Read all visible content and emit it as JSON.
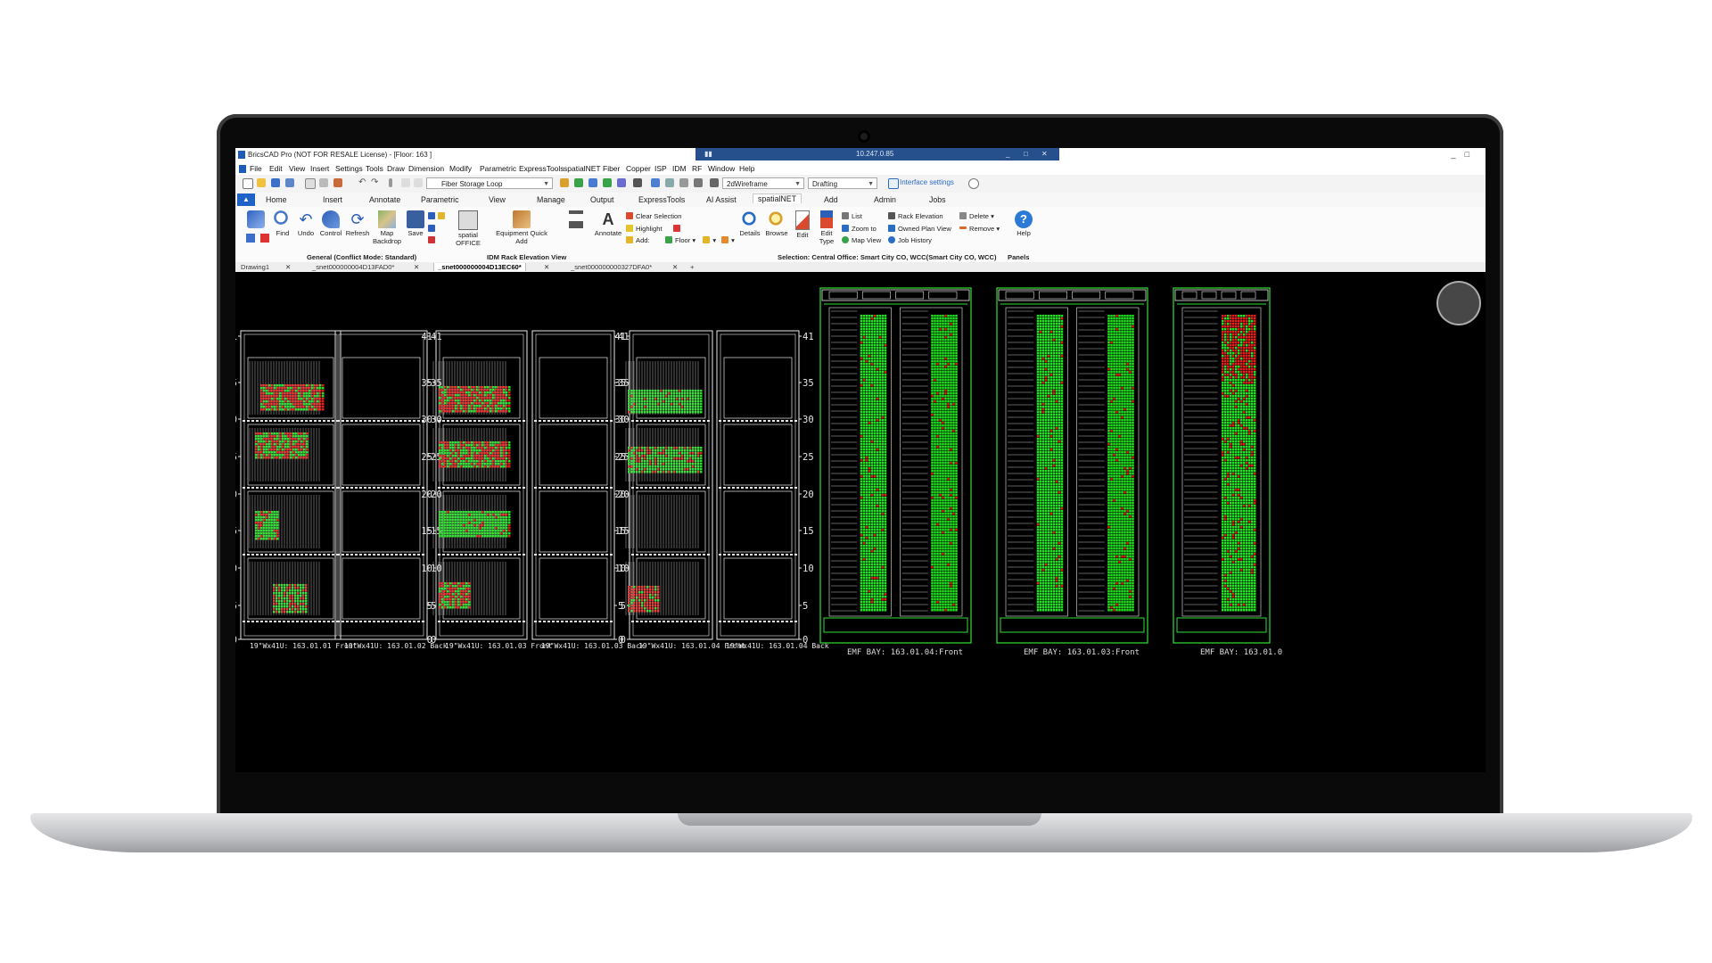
{
  "window": {
    "title": "BricsCAD Pro (NOT FOR RESALE License) - [Floor: 163 ]",
    "remote_host": "10.247.0.85",
    "controls": [
      "_",
      "□",
      "✕"
    ]
  },
  "menu": [
    "File",
    "Edit",
    "View",
    "Insert",
    "Settings",
    "Tools",
    "Draw",
    "Dimension",
    "Modify",
    "Parametric",
    "ExpressTools",
    "spatialNET",
    "Fiber",
    "Copper",
    "ISP",
    "IDM",
    "RF",
    "Window",
    "Help"
  ],
  "toolbar": {
    "layer_combo": "Fiber Storage Loop",
    "visual_style": "2dWireframe",
    "workspace": "Drafting",
    "interface_settings": "Interface settings"
  },
  "tabs": [
    "Home",
    "Insert",
    "Annotate",
    "Parametric",
    "View",
    "Manage",
    "Output",
    "ExpressTools",
    "AI Assist",
    "spatialNET",
    "Add",
    "Admin",
    "Jobs"
  ],
  "active_tab": "spatialNET",
  "ribbon": {
    "buttons": [
      "Find",
      "Undo",
      "Control",
      "Refresh",
      "Map Backdrop",
      "Save",
      "spatial OFFICE",
      "Equipment Quick Add",
      "Annotate",
      "Details",
      "Browse",
      "Edit",
      "Edit Type",
      "Help"
    ],
    "small_buttons": [
      "Clear Selection",
      "Highlight",
      "Add:",
      "Floor",
      "List",
      "Zoom to",
      "Map View",
      "Rack Elevation",
      "Owned Plan View",
      "Job History",
      "Delete",
      "Remove"
    ],
    "group_general": "General (Conflict Mode: Standard)",
    "group_idm": "IDM Rack Elevation View",
    "selection": "Selection: Central Office: Smart City CO, WCC(Smart City CO, WCC)",
    "panels": "Panels"
  },
  "doc_tabs": [
    "Drawing1",
    "_snet000000004D13FAD0*",
    "_snet000000004D13EC60*",
    "_snet000000000327DFA0*"
  ],
  "active_doc_tab": "_snet000000004D13EC60*",
  "drawing": {
    "rack_ticks": [
      "41",
      "35",
      "30",
      "25",
      "20",
      "15",
      "10",
      "5",
      "0"
    ],
    "rack_captions": [
      "19\"Wx41U: 163.01.01 Front",
      "19\"Wx41U: 163.01.02 Back",
      "19\"Wx41U: 163.01.03 Front",
      "19\"Wx41U: 163.01.03 Back",
      "19\"Wx41U: 163.01.04 Front",
      "19\"Wx41U: 163.01.04 Back"
    ],
    "bay_captions": [
      "EMF BAY: 163.01.04:Front",
      "EMF BAY: 163.01.03:Front",
      "EMF BAY: 163.01.0"
    ],
    "colors": {
      "wire": "#e8e8e8",
      "ports_ok": "#22e022",
      "ports_alarm": "#e0201c",
      "bay_frame": "#34e034"
    }
  }
}
